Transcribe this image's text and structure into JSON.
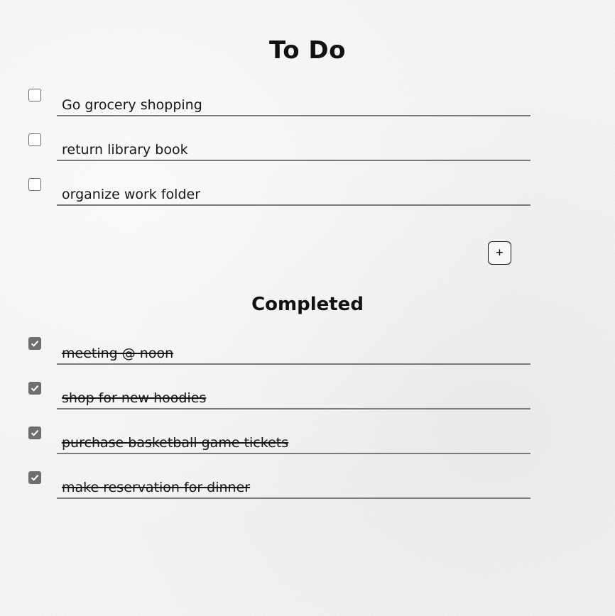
{
  "todo": {
    "title": "To Do",
    "items": [
      {
        "label": "Go grocery shopping",
        "checked": false
      },
      {
        "label": "return library book",
        "checked": false
      },
      {
        "label": "organize work folder",
        "checked": false
      }
    ]
  },
  "add_button": {
    "label": "+"
  },
  "completed": {
    "title": "Completed",
    "items": [
      {
        "label": "meeting @ noon",
        "checked": true
      },
      {
        "label": "shop for new hoodies",
        "checked": true
      },
      {
        "label": "purchase basketball game tickets",
        "checked": true
      },
      {
        "label": "make reservation for dinner",
        "checked": true
      }
    ]
  },
  "icons": {
    "checkbox_checked": "check-icon",
    "add": "plus-icon"
  },
  "colors": {
    "checkbox_checked_fill": "#6e6e6e",
    "underline": "#7a7a7a",
    "text": "#161616"
  }
}
